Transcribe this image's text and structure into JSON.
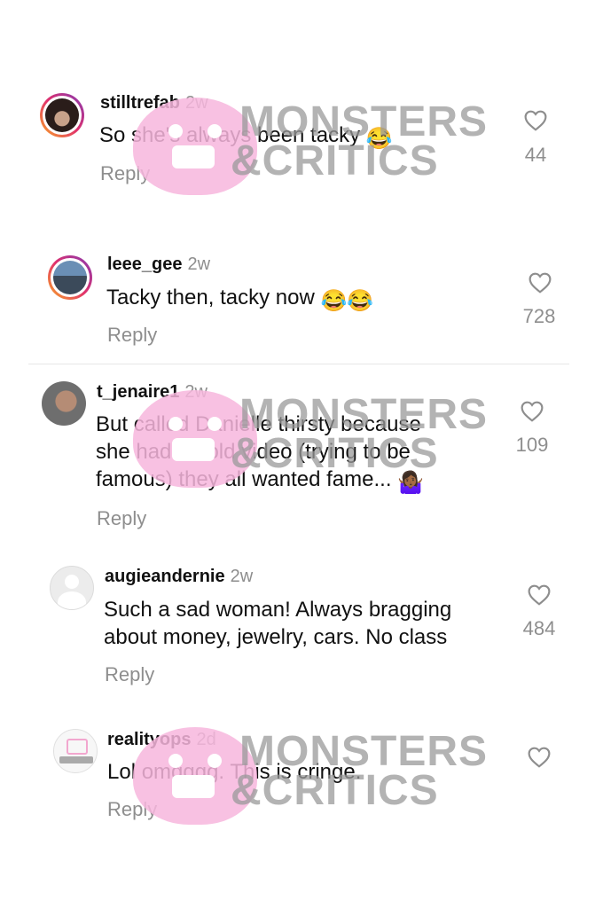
{
  "comments": [
    {
      "username": "stilltrefab",
      "time": "2w",
      "lines": [
        "So she's always been tacky"
      ],
      "emoji": "😂",
      "reply": "Reply",
      "likes": "44"
    },
    {
      "username": "leee_gee",
      "time": "2w",
      "lines": [
        "Tacky then, tacky now"
      ],
      "emoji": "😂😂",
      "reply": "Reply",
      "likes": "728"
    },
    {
      "username": "t_jenaire1",
      "time": "2w",
      "lines": [
        "But called Danielle thirsty because",
        "she had an old video (trying to be",
        "famous) they all wanted fame..."
      ],
      "emoji": "🤷🏾‍♀️",
      "reply": "Reply",
      "likes": "109"
    },
    {
      "username": "augieandernie",
      "time": "2w",
      "lines": [
        "Such a sad woman!  Always bragging",
        "about money, jewelry, cars.  No class"
      ],
      "emoji": "",
      "reply": "Reply",
      "likes": "484"
    },
    {
      "username": "realityops",
      "time": "2d",
      "lines": [
        "Lol omgggg. This is cringe."
      ],
      "emoji": "",
      "reply": "Reply",
      "likes": ""
    }
  ],
  "watermark": {
    "line1": "MONSTERS",
    "line2": "&CRITICS",
    "color": "#f7b6dd"
  },
  "avatar_icons": [
    "crown-portrait-icon",
    "group-photo-icon",
    "portrait-icon",
    "default-user-icon",
    "reality-ops-logo-icon"
  ],
  "colors": {
    "muted": "#8e8e8e",
    "text": "#111111",
    "ring_start": "#f9a825",
    "ring_end": "#833ab4"
  }
}
